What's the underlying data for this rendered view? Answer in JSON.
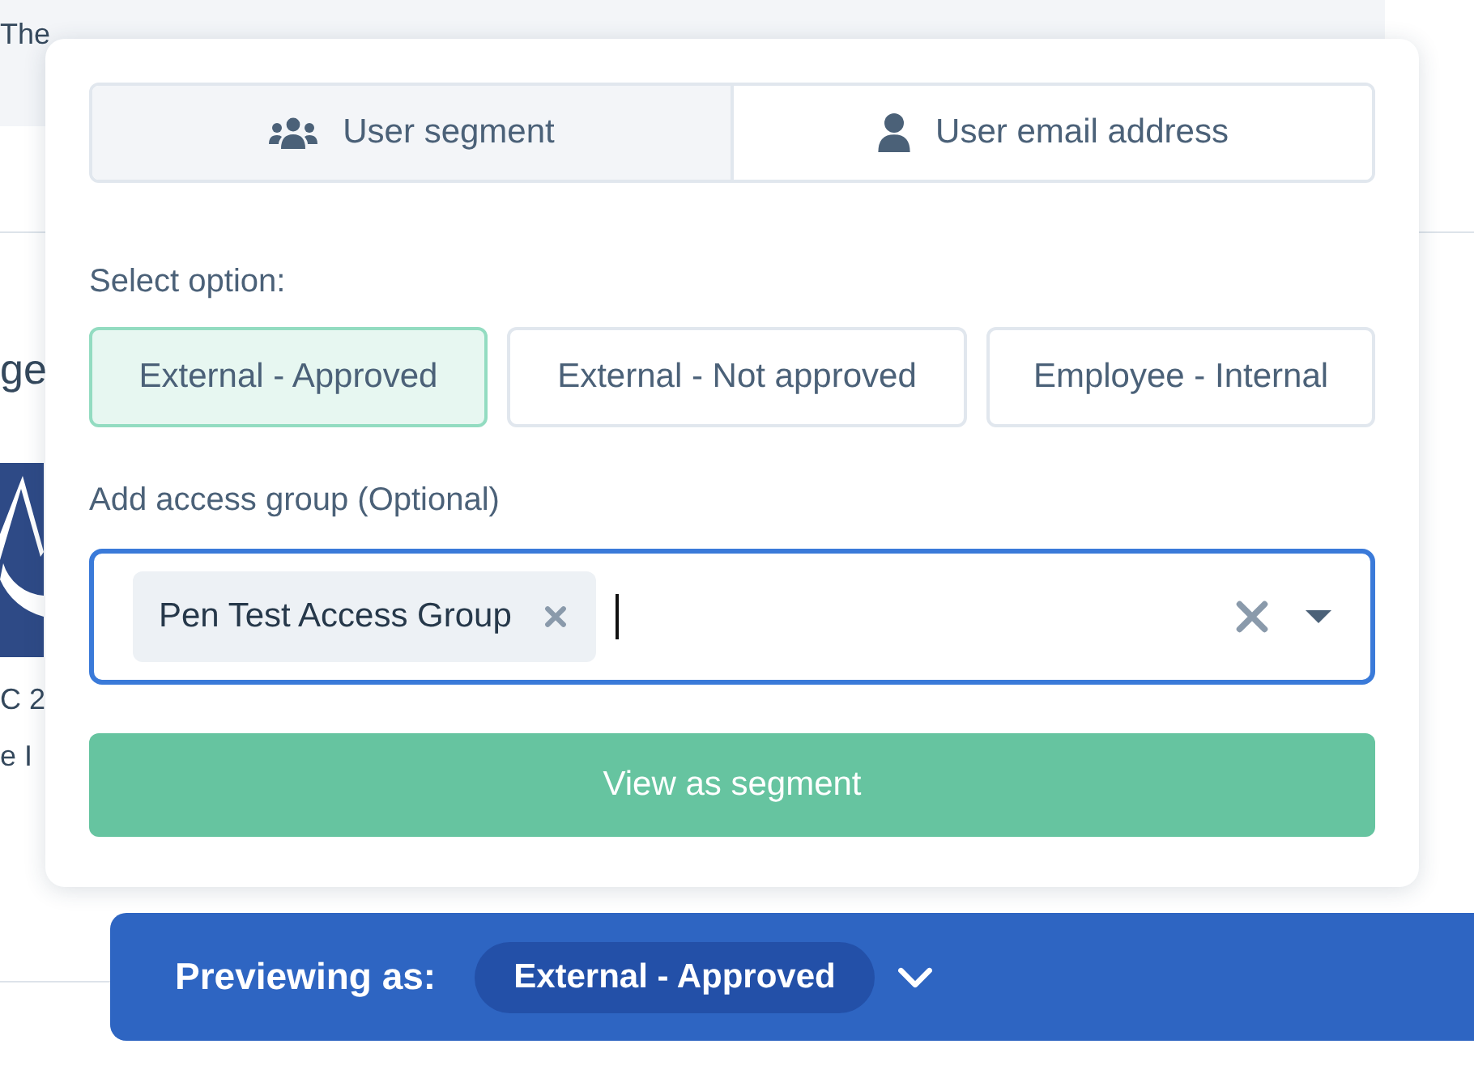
{
  "background": {
    "header_fragment": "The",
    "fragments": [
      "ge",
      "C 2",
      "e I"
    ]
  },
  "popup": {
    "tabs": [
      {
        "label": "User segment",
        "kind": "group",
        "selected": true
      },
      {
        "label": "User email address",
        "kind": "person",
        "selected": false
      }
    ],
    "option_label": "Select option:",
    "options": [
      {
        "label": "External - Approved",
        "selected": true
      },
      {
        "label": "External - Not approved",
        "selected": false
      },
      {
        "label": "Employee - Internal",
        "selected": false
      }
    ],
    "group_label": "Add access group (Optional)",
    "group_field": {
      "tags": [
        "Pen Test Access Group"
      ],
      "focused": true
    },
    "submit": "View as segment"
  },
  "preview_bar": {
    "label": "Previewing as:",
    "value": "External - Approved"
  }
}
